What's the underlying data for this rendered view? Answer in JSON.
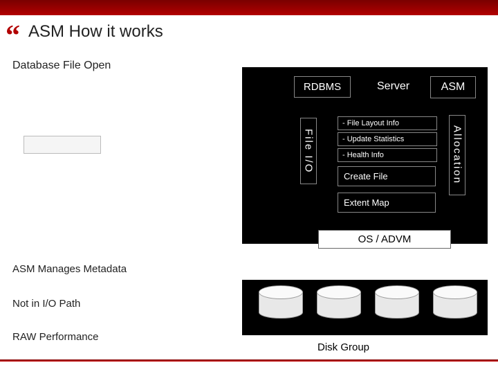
{
  "title": "ASM How it works",
  "subtitle": "Database File Open",
  "headers": {
    "rdbms": "RDBMS",
    "server": "Server",
    "asm": "ASM"
  },
  "side_labels": {
    "fileio": "File I/O",
    "allocation": "Allocation"
  },
  "messages": {
    "m1": "- File Layout Info",
    "m2": "- Update Statistics",
    "m3": "- Health Info",
    "create_file": "Create File",
    "extent_map": "Extent Map"
  },
  "os_label": "OS / ADVM",
  "disk_group": "Disk Group",
  "bullets": {
    "b1": "ASM Manages Metadata",
    "b2": "Not in I/O Path",
    "b3": "RAW Performance"
  }
}
